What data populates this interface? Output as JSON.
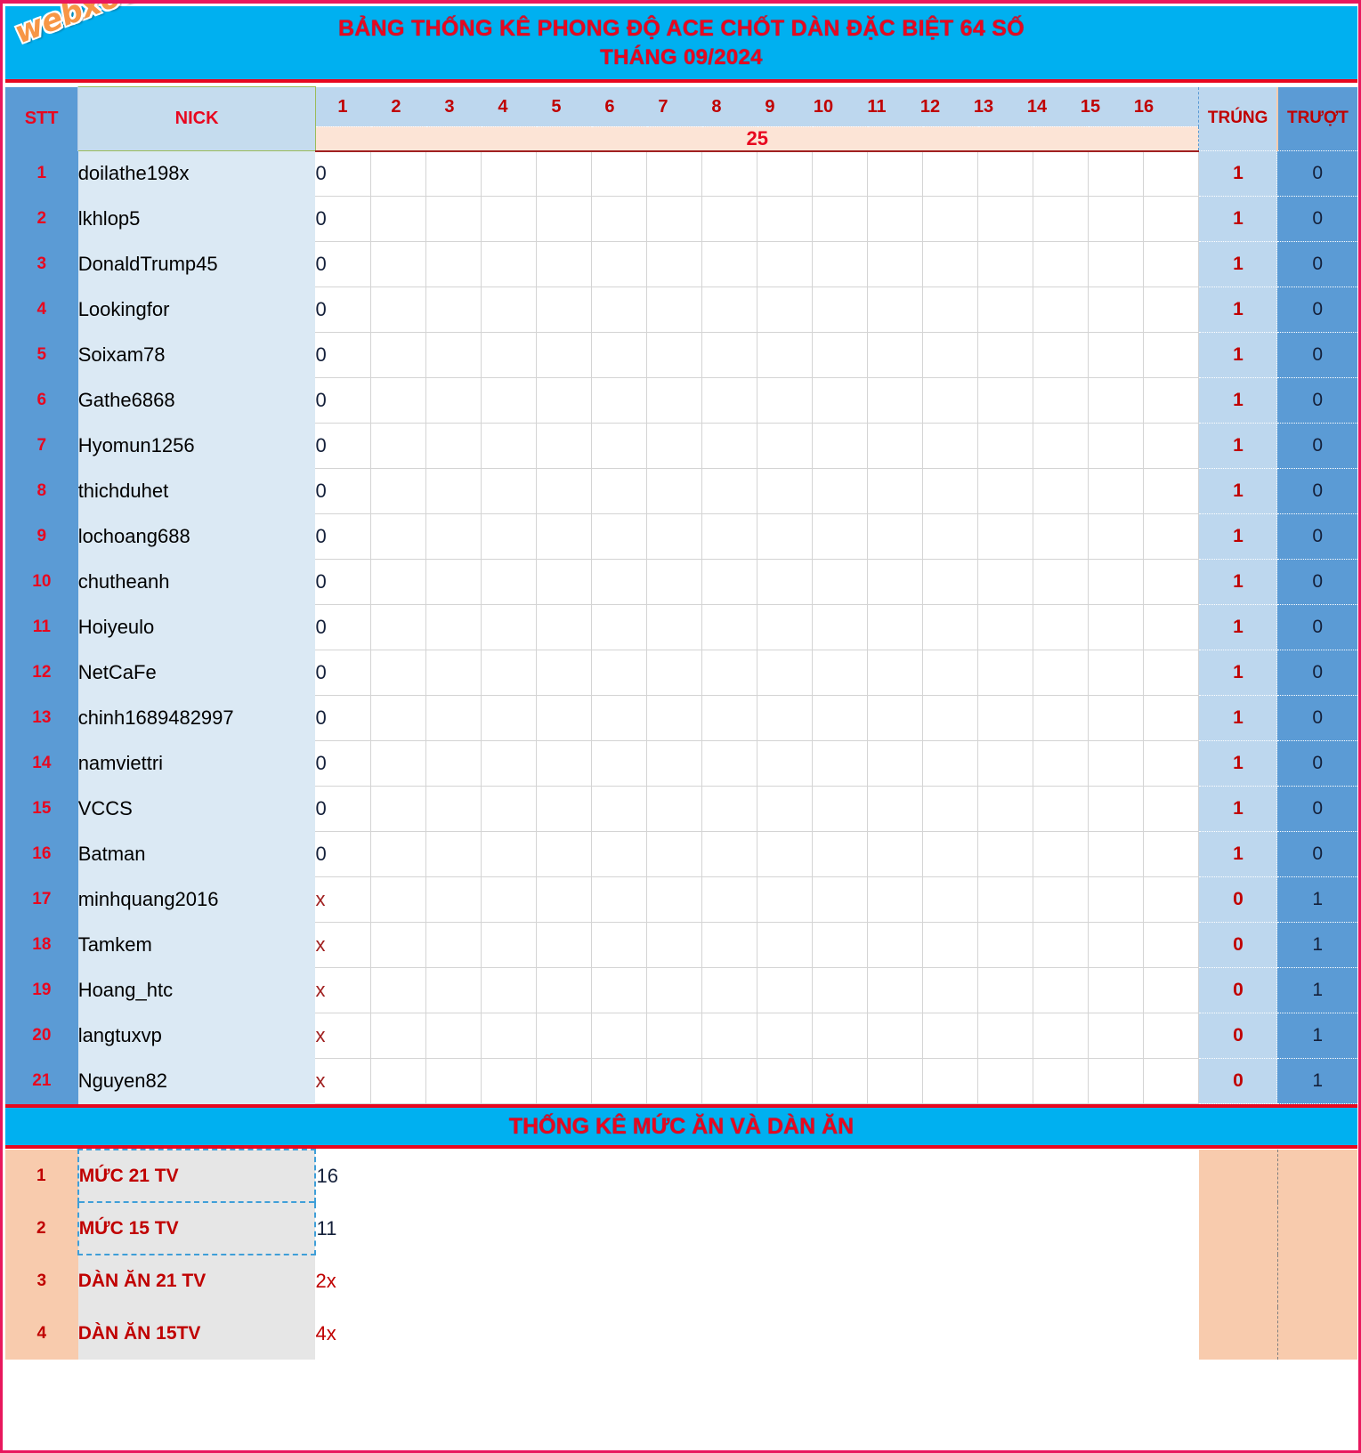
{
  "header": {
    "title_line1": "BẢNG THỐNG KÊ PHONG ĐỘ ACE CHỐT DÀN ĐẶC BIỆT 64 SỐ",
    "title_line2": "THÁNG 09/2024",
    "watermark": "webxoso.net"
  },
  "table": {
    "col_stt": "STT",
    "col_nick": "NICK",
    "col_trung": "TRÚNG",
    "col_truot": "TRƯỢT",
    "day_columns": [
      "1",
      "2",
      "3",
      "4",
      "5",
      "6",
      "7",
      "8",
      "9",
      "10",
      "11",
      "12",
      "13",
      "14",
      "15",
      "16"
    ],
    "subheader_value": "25",
    "rows": [
      {
        "stt": "1",
        "nick": "doilathe198x",
        "v1": "0",
        "trung": "1",
        "truot": "0"
      },
      {
        "stt": "2",
        "nick": "lkhlop5",
        "v1": "0",
        "trung": "1",
        "truot": "0"
      },
      {
        "stt": "3",
        "nick": "DonaldTrump45",
        "v1": "0",
        "trung": "1",
        "truot": "0"
      },
      {
        "stt": "4",
        "nick": "Lookingfor",
        "v1": "0",
        "trung": "1",
        "truot": "0"
      },
      {
        "stt": "5",
        "nick": "Soixam78",
        "v1": "0",
        "trung": "1",
        "truot": "0"
      },
      {
        "stt": "6",
        "nick": "Gathe6868",
        "v1": "0",
        "trung": "1",
        "truot": "0"
      },
      {
        "stt": "7",
        "nick": "Hyomun1256",
        "v1": "0",
        "trung": "1",
        "truot": "0"
      },
      {
        "stt": "8",
        "nick": "thichduhet",
        "v1": "0",
        "trung": "1",
        "truot": "0"
      },
      {
        "stt": "9",
        "nick": "lochoang688",
        "v1": "0",
        "trung": "1",
        "truot": "0"
      },
      {
        "stt": "10",
        "nick": "chutheanh",
        "v1": "0",
        "trung": "1",
        "truot": "0"
      },
      {
        "stt": "11",
        "nick": "Hoiyeulo",
        "v1": "0",
        "trung": "1",
        "truot": "0"
      },
      {
        "stt": "12",
        "nick": "NetCaFe",
        "v1": "0",
        "trung": "1",
        "truot": "0"
      },
      {
        "stt": "13",
        "nick": "chinh1689482997",
        "v1": "0",
        "trung": "1",
        "truot": "0"
      },
      {
        "stt": "14",
        "nick": "namviettri",
        "v1": "0",
        "trung": "1",
        "truot": "0"
      },
      {
        "stt": "15",
        "nick": "VCCS",
        "v1": "0",
        "trung": "1",
        "truot": "0"
      },
      {
        "stt": "16",
        "nick": "Batman",
        "v1": "0",
        "trung": "1",
        "truot": "0"
      },
      {
        "stt": "17",
        "nick": "minhquang2016",
        "v1": "x",
        "trung": "0",
        "truot": "1"
      },
      {
        "stt": "18",
        "nick": "Tamkem",
        "v1": "x",
        "trung": "0",
        "truot": "1"
      },
      {
        "stt": "19",
        "nick": "Hoang_htc",
        "v1": "x",
        "trung": "0",
        "truot": "1"
      },
      {
        "stt": "20",
        "nick": "langtuxvp",
        "v1": "x",
        "trung": "0",
        "truot": "1"
      },
      {
        "stt": "21",
        "nick": "Nguyen82",
        "v1": "x",
        "trung": "0",
        "truot": "1"
      }
    ]
  },
  "footer": {
    "banner_title": "THỐNG KÊ MỨC ĂN VÀ DÀN ĂN",
    "rows": [
      {
        "stt": "1",
        "label": "MỨC 21 TV",
        "value": "16",
        "red": false
      },
      {
        "stt": "2",
        "label": "MỨC 15 TV",
        "value": "11",
        "red": false
      },
      {
        "stt": "3",
        "label": "DÀN ĂN 21 TV",
        "value": "2x",
        "red": true
      },
      {
        "stt": "4",
        "label": "DÀN ĂN 15TV",
        "value": "4x",
        "red": true
      }
    ]
  },
  "colors": {
    "banner_blue": "#00b0f0",
    "accent_red": "#e8071f",
    "header_blue": "#5b9bd5",
    "light_blue": "#bdd7ee",
    "peach": "#f8cbad",
    "cream": "#fce4d6"
  }
}
